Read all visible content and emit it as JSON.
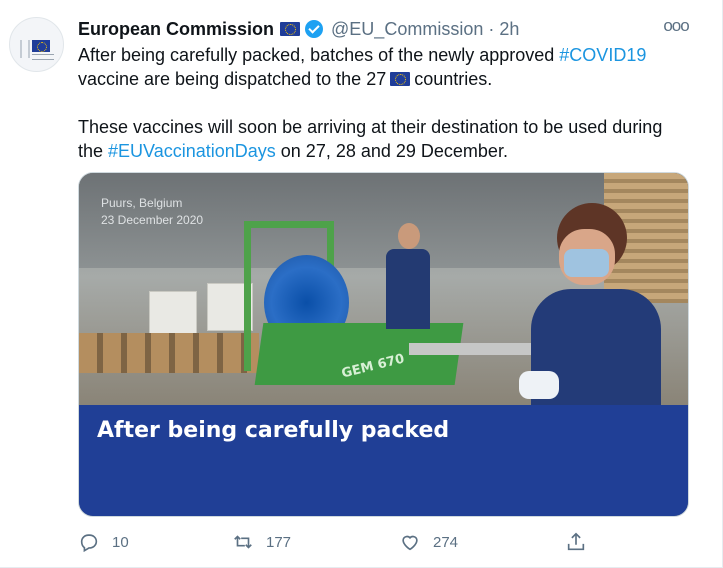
{
  "tweet": {
    "author_name": "European Commission",
    "handle": "@EU_Commission",
    "separator": "·",
    "time": "2h",
    "more_icon": "ooo",
    "text": {
      "line1_pre": "After being carefully packed, batches of the newly approved ",
      "hashtag1": "#COVID19",
      "line2_pre": "vaccine are being dispatched to the 27",
      "line2_post": "countries.",
      "line3": "These vaccines will soon be arriving at their destination to be used during",
      "line4_pre": "the ",
      "hashtag2": "#EUVaccinationDays",
      "line4_post": " on 27, 28 and 29 December."
    },
    "media": {
      "location": "Puurs, Belgium",
      "date": "23 December 2020",
      "machine_label": "GEM 670",
      "banner": "After being carefully packed"
    },
    "actions": {
      "reply_count": "10",
      "retweet_count": "177",
      "like_count": "274"
    },
    "colors": {
      "link": "#1b95e0",
      "verified": "#1da1f2",
      "banner": "#203f96",
      "muted": "#5b7083"
    }
  }
}
